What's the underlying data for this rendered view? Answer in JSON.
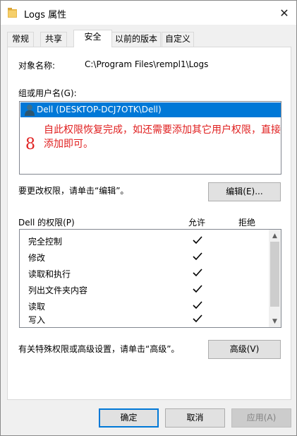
{
  "window": {
    "title": "Logs 属性",
    "close_glyph": "✕"
  },
  "tabs": [
    {
      "label": "常规",
      "active": false
    },
    {
      "label": "共享",
      "active": false
    },
    {
      "label": "安全",
      "active": true
    },
    {
      "label": "以前的版本",
      "active": false
    },
    {
      "label": "自定义",
      "active": false
    }
  ],
  "security": {
    "object_name_label": "对象名称:",
    "object_name_value": "C:\\Program Files\\rempl1\\Logs",
    "groups_label": "组或用户名(G):",
    "users": [
      {
        "name": "Dell (DESKTOP-DCJ7OTK\\Dell)",
        "selected": true,
        "icon": "user-icon"
      }
    ],
    "annotation_number": "8",
    "annotation_text": "自此权限恢复完成，如还需要添加其它用户权限，直接添加即可。",
    "annotation_color": "#e02020",
    "change_hint": "要更改权限，请单击“编辑”。",
    "edit_button": "编辑(E)...",
    "permissions_label": "Dell 的权限(P)",
    "allow_header": "允许",
    "deny_header": "拒绝",
    "permissions": [
      {
        "name": "完全控制",
        "allow": true,
        "deny": false
      },
      {
        "name": "修改",
        "allow": true,
        "deny": false
      },
      {
        "name": "读取和执行",
        "allow": true,
        "deny": false
      },
      {
        "name": "列出文件夹内容",
        "allow": true,
        "deny": false
      },
      {
        "name": "读取",
        "allow": true,
        "deny": false
      },
      {
        "name": "写入",
        "allow": true,
        "deny": false
      }
    ],
    "advanced_hint": "有关特殊权限或高级设置，请单击“高级”。",
    "advanced_button": "高级(V)"
  },
  "footer": {
    "ok": "确定",
    "cancel": "取消",
    "apply": "应用(A)"
  },
  "colors": {
    "selection": "#0078d7",
    "primary_border": "#0078d7"
  }
}
